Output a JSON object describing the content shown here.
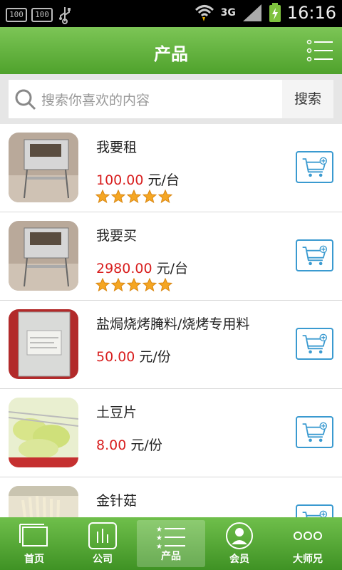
{
  "status_bar": {
    "sim_1": "100",
    "sim_2": "100",
    "network": "3G",
    "time": "16:16"
  },
  "header": {
    "title": "产品"
  },
  "search": {
    "placeholder": "搜索你喜欢的内容",
    "button": "搜索"
  },
  "products": [
    {
      "name": "我要租",
      "price": "100.00",
      "unit": "元/台",
      "rating": 5
    },
    {
      "name": "我要买",
      "price": "2980.00",
      "unit": "元/台",
      "rating": 5
    },
    {
      "name": "盐焗烧烤腌料/烧烤专用料",
      "price": "50.00",
      "unit": "元/份"
    },
    {
      "name": "土豆片",
      "price": "8.00",
      "unit": "元/份"
    },
    {
      "name": "金针菇"
    }
  ],
  "bottom_nav": [
    {
      "label": "首页",
      "icon": "home-icon"
    },
    {
      "label": "公司",
      "icon": "company-icon"
    },
    {
      "label": "产品",
      "icon": "product-list-icon",
      "active": true
    },
    {
      "label": "会员",
      "icon": "member-icon"
    },
    {
      "label": "大师兄",
      "icon": "more-icon"
    }
  ],
  "colors": {
    "brand_green": "#5aab35",
    "price_red": "#d81e1e",
    "cart_blue": "#3a9ad0"
  }
}
